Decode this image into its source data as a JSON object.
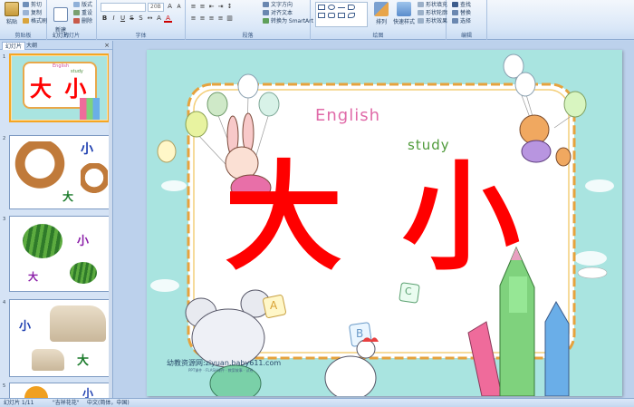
{
  "ribbon": {
    "clipboard": {
      "paste": "粘贴",
      "cut": "剪切",
      "copy": "复制",
      "format_painter": "格式刷",
      "label": "剪贴板"
    },
    "slides": {
      "new_slide": "新建\n幻灯片",
      "layout": "版式",
      "reset": "重设",
      "delete": "删除",
      "label": "幻灯片"
    },
    "font": {
      "font_name": "",
      "font_size": "20B",
      "label": "字体"
    },
    "paragraph": {
      "text_direction": "文字方向",
      "align_text": "对齐文本",
      "smartart": "转换为 SmartArt",
      "label": "段落"
    },
    "drawing": {
      "arrange": "排列",
      "quick_styles": "快速样式",
      "shape_fill": "形状填充",
      "shape_outline": "形状轮廓",
      "shape_effects": "形状效果",
      "label": "绘图"
    },
    "editing": {
      "find": "查找",
      "replace": "替换",
      "select": "选择",
      "label": "编辑"
    }
  },
  "panel": {
    "tab_slides": "幻灯片",
    "tab_outline": "大纲",
    "close": "×",
    "thumbs": [
      {
        "num": "1",
        "title": "大 小",
        "sub1": "English",
        "sub2": "study"
      },
      {
        "num": "2",
        "word_small": "小",
        "word_big": "大"
      },
      {
        "num": "3",
        "word_small": "小",
        "word_big": "大"
      },
      {
        "num": "4",
        "word_small": "小",
        "word_big": "大"
      },
      {
        "num": "5",
        "word_small": "小"
      }
    ]
  },
  "slide": {
    "title_big": "大",
    "title_small": "小",
    "english": "English",
    "study": "study",
    "letter_a": "A",
    "letter_b": "B",
    "letter_c": "C",
    "watermark": "幼教资源网:ziyuan.baby611.com",
    "watermark_sub": "PPT课件 · FLASH课件 · 教案故事 · 试卷"
  },
  "status": {
    "slide_info": "幻灯片 1/11",
    "theme": "\"吉祥花花\"",
    "language": "中文(简体，中国)"
  },
  "colors": {
    "title": "#ff0000",
    "slide_bg": "#a9e4e0",
    "selection": "#f5a623"
  }
}
